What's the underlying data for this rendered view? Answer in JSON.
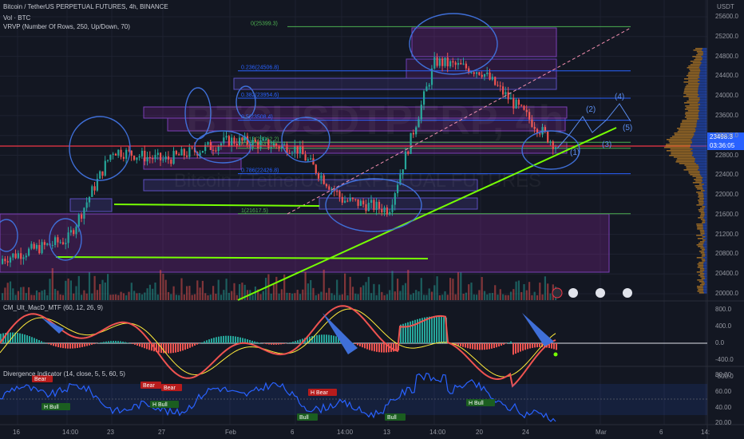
{
  "header": {
    "title": "Bitcoin / TetherUS PERPETUAL FUTURES, 4h, BINANCE",
    "vol": "Vol · BTC",
    "vrvp": "VRVP (Number Of Rows, 250, Up/Down, 70)",
    "currency": "USDT"
  },
  "watermark": {
    "line1": "BTCUSDTPERP, 4h",
    "line2": "Bitcoin / TetherUS PERPETUAL FUTURES"
  },
  "price_badge": {
    "price": "23498.3",
    "countdown": "03:36:05"
  },
  "price_axis": [
    "25600.0",
    "25200.0",
    "24800.0",
    "24400.0",
    "24000.0",
    "23600.0",
    "23200.0",
    "22800.0",
    "22400.0",
    "22000.0",
    "21600.0",
    "21200.0",
    "20800.0",
    "20400.0",
    "20000.0"
  ],
  "time_axis": [
    "16",
    "14:00",
    "23",
    "27",
    "Feb",
    "6",
    "14:00",
    "13",
    "14:00",
    "20",
    "24",
    "Mar",
    "6",
    "14:"
  ],
  "fib_levels": [
    {
      "label": "0(25399.3)",
      "price": 25399.3,
      "color": "#4caf50"
    },
    {
      "label": "0.236(24506.8)",
      "price": 24506.8,
      "color": "#2962ff"
    },
    {
      "label": "0.382(23954.6)",
      "price": 23954.6,
      "color": "#2962ff"
    },
    {
      "label": "0.5(23508.4)",
      "price": 23508.4,
      "color": "#2962ff"
    },
    {
      "label": "0.618(23062.2)",
      "price": 23062.2,
      "color": "#4caf50"
    },
    {
      "label": "0.65(22941.3)",
      "price": 22941.3,
      "color": "#4caf50"
    },
    {
      "label": "0.786(22426.8)",
      "price": 22426.8,
      "color": "#2962ff"
    },
    {
      "label": "1(21617.5)",
      "price": 21617.5,
      "color": "#4caf50"
    }
  ],
  "wave_labels": [
    "(1)",
    "(2)",
    "(3)",
    "(4)",
    "(5)"
  ],
  "macd": {
    "legend": "CM_Ult_MacD_MTF (60, 12, 26, 9)",
    "axis": [
      "800.0",
      "400.0",
      "0.0",
      "-400.0",
      "-800.0"
    ]
  },
  "divergence": {
    "legend": "Divergence Indicator (14, close, 5, 5, 60, 5)",
    "axis": [
      "80.00",
      "60.00",
      "40.00",
      "20.00"
    ],
    "tags": [
      {
        "text": "Bear",
        "kind": "bear"
      },
      {
        "text": "Bear",
        "kind": "bear"
      },
      {
        "text": "Bear",
        "kind": "bear"
      },
      {
        "text": "H Bull",
        "kind": "bull"
      },
      {
        "text": "H Bull",
        "kind": "bull"
      },
      {
        "text": "H Bear",
        "kind": "bear"
      },
      {
        "text": "Bull",
        "kind": "bull"
      },
      {
        "text": "Bull",
        "kind": "bull"
      },
      {
        "text": "H Bull",
        "kind": "bull"
      }
    ]
  },
  "chart_data": {
    "type": "line",
    "title": "Bitcoin / TetherUS PERPETUAL FUTURES, 4h, BINANCE",
    "ylim": [
      20000,
      25700
    ],
    "x": [
      "16",
      "14:00",
      "23",
      "27",
      "Feb",
      "6",
      "14:00",
      "13",
      "14:00",
      "20",
      "24"
    ],
    "series": [
      {
        "name": "close",
        "values": [
          20700,
          21100,
          22900,
          22700,
          23100,
          22950,
          21900,
          21700,
          24700,
          24500,
          23000
        ]
      }
    ],
    "horizontal_line": 22950
  },
  "colors": {
    "background": "#131722",
    "up": "#26a69a",
    "down": "#ef5350",
    "trend": "#76ff03",
    "drawing": "#3f6fd8"
  }
}
